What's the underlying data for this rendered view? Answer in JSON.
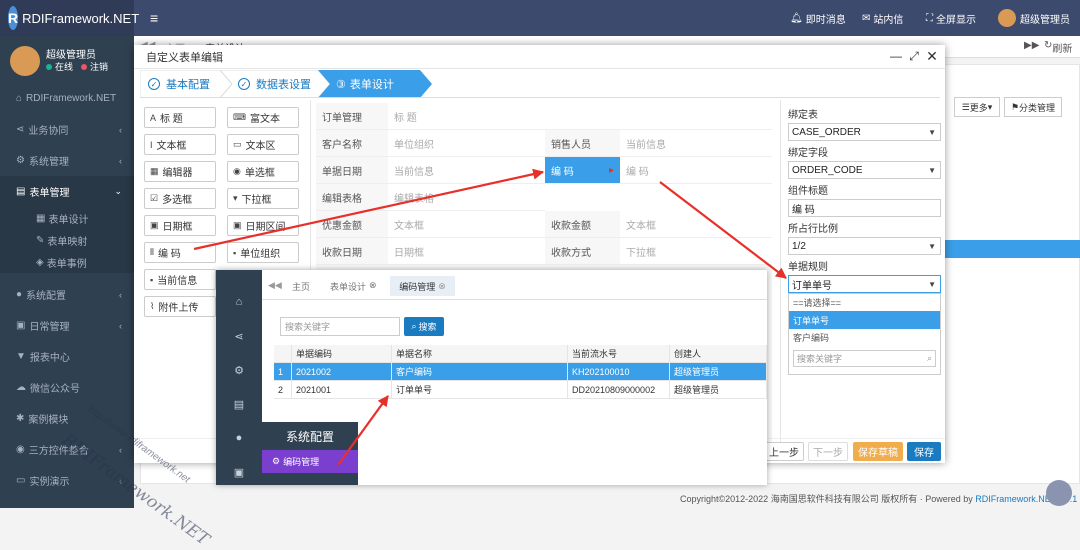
{
  "app": {
    "brand": "RDIFramework.NET"
  },
  "topbar": {
    "items": [
      "即时消息",
      "站内信",
      "全屏显示",
      "超级管理员"
    ]
  },
  "user": {
    "name": "超级管理员",
    "status": "在线",
    "logout": "注销"
  },
  "sidebar": {
    "items": [
      "RDIFramework.NET",
      "业务协同",
      "系统管理",
      "表单管理",
      "系统配置",
      "日常管理",
      "报表中心",
      "微信公众号",
      "案例模块",
      "三方控件整合",
      "实例演示"
    ],
    "subitems": [
      "表单设计",
      "表单映射",
      "表单事例"
    ]
  },
  "bg": {
    "tabs": [
      "主页",
      "表单设计"
    ],
    "refresh": "刷新",
    "more": "更多",
    "category": "分类管理"
  },
  "modal": {
    "title": "自定义表单编辑",
    "steps": [
      "基本配置",
      "数据表设置",
      "表单设计"
    ],
    "step3_num": "③",
    "controls": [
      "标 题",
      "富文本",
      "文本框",
      "文本区",
      "编辑器",
      "单选框",
      "多选框",
      "下拉框",
      "日期框",
      "日期区间",
      "编 码",
      "单位组织",
      "当前信息",
      "附件上传"
    ],
    "form": {
      "title_row": {
        "label": "订单管理",
        "value": "标 题"
      },
      "rows": [
        [
          "客户名称",
          "单位组织",
          "销售人员",
          "当前信息"
        ],
        [
          "单据日期",
          "当前信息",
          "编 码",
          "编 码"
        ],
        [
          "编辑表格",
          "编辑表格",
          "",
          ""
        ],
        [
          "优惠金额",
          "文本框",
          "收款金额",
          "文本框"
        ],
        [
          "收款日期",
          "日期框",
          "收款方式",
          "下拉框"
        ]
      ]
    },
    "props": {
      "bind_table_label": "绑定表",
      "bind_table": "CASE_ORDER",
      "bind_field_label": "绑定字段",
      "bind_field": "ORDER_CODE",
      "comp_title_label": "组件标题",
      "comp_title": "编 码",
      "ratio_label": "所占行比例",
      "ratio": "1/2",
      "rule_label": "单据规则",
      "rule": "订单单号",
      "options": [
        "==请选择==",
        "订单单号",
        "客户编码"
      ],
      "search_placeholder": "搜索关键字"
    },
    "buttons": {
      "prev": "上一步",
      "next": "下一步",
      "draft": "保存草稿",
      "save": "保存"
    }
  },
  "inset": {
    "tabs": [
      "主页",
      "表单设计",
      "编码管理"
    ],
    "search_placeholder": "搜索关键字",
    "search_btn": "搜索",
    "menu_title": "系统配置",
    "menu_item": "编码管理",
    "columns": [
      "单据编码",
      "单据名称",
      "当前流水号",
      "创建人"
    ],
    "rows": [
      [
        "1",
        "2021002",
        "客户编码",
        "KH202100010",
        "超级管理员"
      ],
      [
        "2",
        "2021001",
        "订单单号",
        "DD20210809000002",
        "超级管理员"
      ]
    ]
  },
  "watermark": {
    "line1": "RDIFramework.NET",
    "line2": "http://www.rdiframework.net"
  },
  "footer": {
    "copyright": "Copyright©2012-2022 海南国思软件科技有限公司 版权所有 · Powered by",
    "brand": "RDIFramework.NET-V5.1"
  },
  "colors": {
    "topbar": "#3c4a6e",
    "sidebar": "#2f4050",
    "accent": "#1a7bc0",
    "active_row": "#3a9fe8",
    "arrow": "#e8302a",
    "draft": "#f0ad4e",
    "menu_active": "#7b3fd0"
  }
}
